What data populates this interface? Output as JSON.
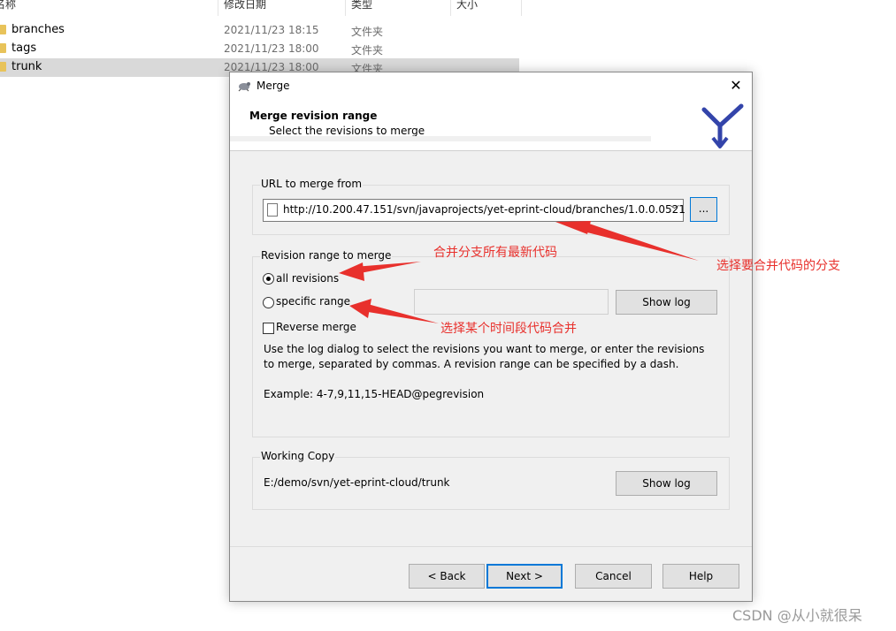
{
  "explorer": {
    "columns": [
      "名称",
      "修改日期",
      "类型",
      "大小"
    ],
    "rows": [
      {
        "name": "branches",
        "date": "2021/11/23 18:15",
        "type": "文件夹"
      },
      {
        "name": "tags",
        "date": "2021/11/23 18:00",
        "type": "文件夹"
      },
      {
        "name": "trunk",
        "date": "2021/11/23 18:00",
        "type": "文件夹"
      }
    ]
  },
  "dialog": {
    "title": "Merge",
    "close_glyph": "✕",
    "header_title": "Merge revision range",
    "header_subtitle": "Select the revisions to merge",
    "url_group": {
      "label": "URL to merge from",
      "url": "http://10.200.47.151/svn/javaprojects/yet-eprint-cloud/branches/1.0.0.0521",
      "browse_label": "..."
    },
    "revision_group": {
      "label": "Revision range to merge",
      "all_revisions": "all revisions",
      "specific_range": "specific range",
      "show_log": "Show log",
      "reverse_merge": "Reverse merge",
      "help_text": "Use the log dialog to select the revisions you want to merge, or enter the revisions to merge, separated by commas. A revision range can be specified by a dash.",
      "example": "Example: 4-7,9,11,15-HEAD@pegrevision"
    },
    "working_copy": {
      "label": "Working Copy",
      "path": "E:/demo/svn/yet-eprint-cloud/trunk",
      "show_log": "Show log"
    },
    "buttons": {
      "back": "< Back",
      "next": "Next >",
      "cancel": "Cancel",
      "help": "Help"
    }
  },
  "annotations": {
    "merge_all": "合并分支所有最新代码",
    "select_branch": "选择要合并代码的分支",
    "select_range": "选择某个时间段代码合并"
  },
  "watermark": "CSDN @从小就很呆",
  "colors": {
    "annotation": "#e8302c",
    "selection": "#d9d9d9",
    "default_button_border": "#0078d7"
  }
}
